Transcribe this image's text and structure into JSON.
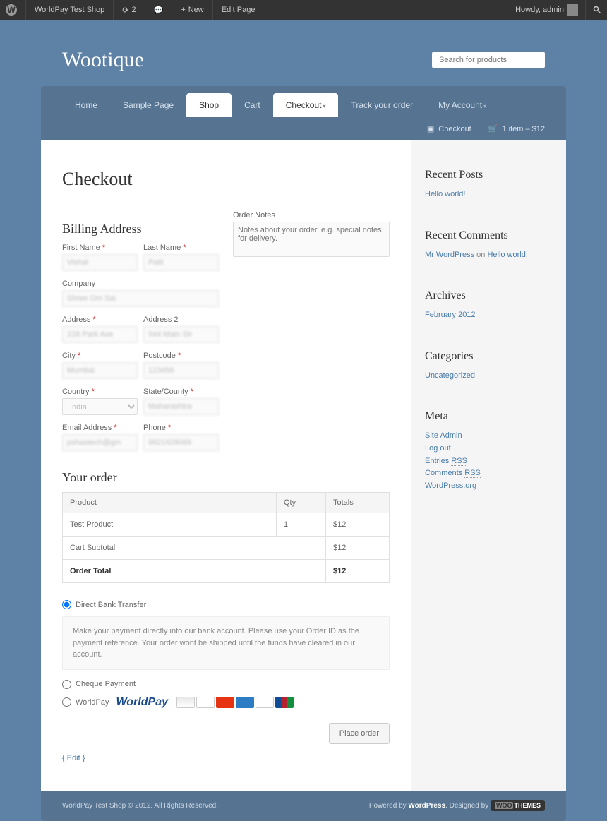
{
  "adminBar": {
    "siteName": "WorldPay Test Shop",
    "refreshCount": "2",
    "newLabel": "New",
    "editLabel": "Edit Page",
    "howdy": "Howdy, admin"
  },
  "header": {
    "siteTitle": "Wootique",
    "searchPlaceholder": "Search for products"
  },
  "nav": {
    "items": [
      "Home",
      "Sample Page",
      "Shop",
      "Cart",
      "Checkout",
      "Track your order",
      "My Account"
    ],
    "activeIndices": [
      2,
      4
    ],
    "checkoutLabel": "Checkout",
    "cartSummary": "1 item – $12"
  },
  "page": {
    "title": "Checkout"
  },
  "billing": {
    "heading": "Billing Address",
    "fields": {
      "firstName": {
        "label": "First Name",
        "required": true,
        "value": "Vishal"
      },
      "lastName": {
        "label": "Last Name",
        "required": true,
        "value": "Patil"
      },
      "company": {
        "label": "Company",
        "required": false,
        "value": "Shree Om Sai"
      },
      "address": {
        "label": "Address",
        "required": true,
        "value": "228 Park Ave"
      },
      "address2": {
        "label": "Address 2",
        "required": false,
        "value": "544 Main Str"
      },
      "city": {
        "label": "City",
        "required": true,
        "value": "Mumbai"
      },
      "postcode": {
        "label": "Postcode",
        "required": true,
        "value": "123456"
      },
      "country": {
        "label": "Country",
        "required": true,
        "value": "India"
      },
      "state": {
        "label": "State/County",
        "required": true,
        "value": "Maharashtra"
      },
      "email": {
        "label": "Email Address",
        "required": true,
        "value": "pshastech@gm"
      },
      "phone": {
        "label": "Phone",
        "required": true,
        "value": "9821928069"
      }
    }
  },
  "orderNotes": {
    "label": "Order Notes",
    "placeholder": "Notes about your order, e.g. special notes for delivery."
  },
  "order": {
    "heading": "Your order",
    "columns": {
      "product": "Product",
      "qty": "Qty",
      "totals": "Totals"
    },
    "items": [
      {
        "product": "Test Product",
        "qty": "1",
        "total": "$12"
      }
    ],
    "subtotalLabel": "Cart Subtotal",
    "subtotal": "$12",
    "totalLabel": "Order Total",
    "total": "$12"
  },
  "payment": {
    "options": {
      "bank": {
        "label": "Direct Bank Transfer",
        "desc": "Make your payment directly into our bank account. Please use your Order ID as the payment reference. Your order wont be shipped until the funds have cleared in our account."
      },
      "cheque": {
        "label": "Cheque Payment"
      },
      "worldpay": {
        "label": "WorldPay",
        "brand": "WorldPay"
      }
    },
    "placeOrder": "Place order"
  },
  "editLink": "{ Edit }",
  "sidebar": {
    "recentPosts": {
      "heading": "Recent Posts",
      "items": [
        "Hello world!"
      ]
    },
    "recentComments": {
      "heading": "Recent Comments",
      "author": "Mr WordPress",
      "on": "on",
      "post": "Hello world!"
    },
    "archives": {
      "heading": "Archives",
      "items": [
        "February 2012"
      ]
    },
    "categories": {
      "heading": "Categories",
      "items": [
        "Uncategorized"
      ]
    },
    "meta": {
      "heading": "Meta",
      "items": [
        "Site Admin",
        "Log out"
      ],
      "entriesRss": {
        "prefix": "Entries ",
        "rss": "RSS"
      },
      "commentsRss": {
        "prefix": "Comments ",
        "rss": "RSS"
      },
      "wporg": "WordPress.org"
    }
  },
  "footer": {
    "left": "WorldPay Test Shop © 2012. All Rights Reserved.",
    "poweredBy": "Powered by ",
    "wordpress": "WordPress",
    "designedBy": ". Designed by "
  }
}
